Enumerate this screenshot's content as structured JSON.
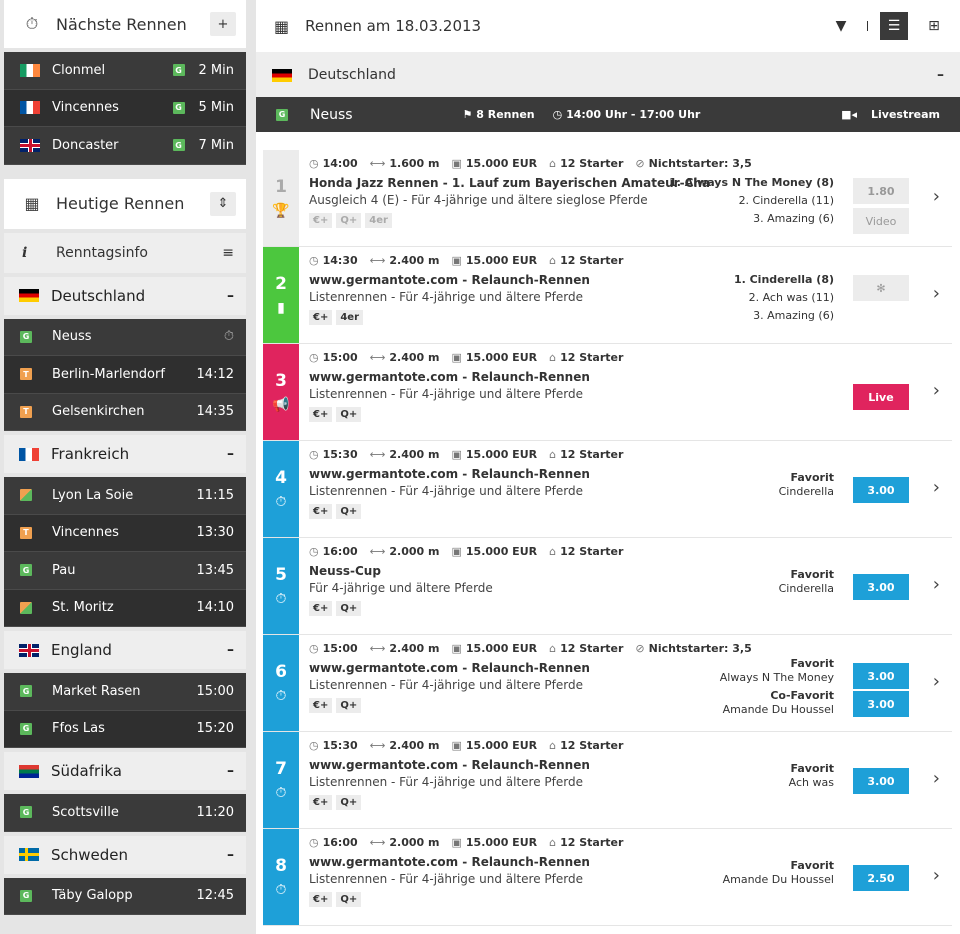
{
  "next_races": {
    "title": "Nächste Rennen",
    "add_icon": "+",
    "items": [
      {
        "name": "Clonmel",
        "type": "G",
        "time": "2 Min",
        "flag": "ie"
      },
      {
        "name": "Vincennes",
        "type": "G",
        "time": "5 Min",
        "flag": "fr"
      },
      {
        "name": "Doncaster",
        "type": "G",
        "time": "7 Min",
        "flag": "gb"
      }
    ]
  },
  "today": {
    "title": "Heutige Rennen",
    "info_label": "Renntagsinfo",
    "countries": [
      {
        "name": "Deutschland",
        "flag": "de",
        "tracks": [
          {
            "name": "Neuss",
            "type": "G",
            "time": ""
          },
          {
            "name": "Berlin-Marlendorf",
            "type": "T",
            "time": "14:12"
          },
          {
            "name": "Gelsenkirchen",
            "type": "T",
            "time": "14:35"
          }
        ]
      },
      {
        "name": "Frankreich",
        "flag": "fr",
        "tracks": [
          {
            "name": "Lyon La Soie",
            "type": "GT",
            "time": "11:15"
          },
          {
            "name": "Vincennes",
            "type": "T",
            "time": "13:30"
          },
          {
            "name": "Pau",
            "type": "G",
            "time": "13:45"
          },
          {
            "name": "St. Moritz",
            "type": "GT",
            "time": "14:10"
          }
        ]
      },
      {
        "name": "England",
        "flag": "gb",
        "tracks": [
          {
            "name": "Market Rasen",
            "type": "G",
            "time": "15:00"
          },
          {
            "name": "Ffos Las",
            "type": "G",
            "time": "15:20"
          }
        ]
      },
      {
        "name": "Südafrika",
        "flag": "za",
        "tracks": [
          {
            "name": "Scottsville",
            "type": "G",
            "time": "11:20"
          }
        ]
      },
      {
        "name": "Schweden",
        "flag": "se",
        "tracks": [
          {
            "name": "Täby Galopp",
            "type": "G",
            "time": "12:45"
          }
        ]
      }
    ]
  },
  "main": {
    "title": "Rennen am 18.03.2013",
    "country": "Deutschland",
    "track": "Neuss",
    "track_type": "G",
    "race_count": "8 Rennen",
    "time_range": "14:00 Uhr - 17:00 Uhr",
    "livestream": "Livestream",
    "races": [
      {
        "num": "1",
        "color": "#ececec",
        "time": "14:00",
        "dist": "1.600 m",
        "purse": "15.000 EUR",
        "starters": "12 Starter",
        "nonstarter": "Nichtstarter: 3,5",
        "title": "Honda Jazz Rennen - 1. Lauf zum Bayerischen Amateur-Cha...",
        "sub": "Ausgleich 4 (E) - Für 4-jährige und ältere sieglose Pferde",
        "tags": [
          "€+",
          "Q+",
          "4er"
        ],
        "results": [
          "1. Always N The Money (8)",
          "2. Cinderella (11)",
          "3. Amazing (6)"
        ],
        "btn": "1.80",
        "btn2": "Video"
      },
      {
        "num": "2",
        "color": "#4cc73e",
        "time": "14:30",
        "dist": "2.400 m",
        "purse": "15.000 EUR",
        "starters": "12 Starter",
        "nonstarter": "",
        "title": "www.germantote.com - Relaunch-Rennen",
        "sub": "Listenrennen - Für 4-jährige und ältere Pferde",
        "tags": [
          "€+",
          "4er"
        ],
        "results": [
          "1. Cinderella (8)",
          "2. Ach was (11)",
          "3. Amazing (6)"
        ],
        "btn": "",
        "btn2": ""
      },
      {
        "num": "3",
        "color": "#e0245e",
        "time": "15:00",
        "dist": "2.400 m",
        "purse": "15.000 EUR",
        "starters": "12 Starter",
        "nonstarter": "",
        "title": "www.germantote.com - Relaunch-Rennen",
        "sub": "Listenrennen - Für 4-jährige und ältere Pferde",
        "tags": [
          "€+",
          "Q+"
        ],
        "results": [],
        "btn": "Live",
        "btn2": ""
      },
      {
        "num": "4",
        "color": "#1ea0d8",
        "time": "15:30",
        "dist": "2.400 m",
        "purse": "15.000 EUR",
        "starters": "12 Starter",
        "nonstarter": "",
        "title": "www.germantote.com - Relaunch-Rennen",
        "sub": "Listenrennen - Für 4-jährige und ältere Pferde",
        "tags": [
          "€+",
          "Q+"
        ],
        "fav": [
          "Favorit",
          "Cinderella"
        ],
        "btn": "3.00",
        "btn2": ""
      },
      {
        "num": "5",
        "color": "#1ea0d8",
        "time": "16:00",
        "dist": "2.000 m",
        "purse": "15.000 EUR",
        "starters": "12 Starter",
        "nonstarter": "",
        "title": "Neuss-Cup",
        "sub": "Für 4-jährige und ältere Pferde",
        "tags": [
          "€+",
          "Q+"
        ],
        "fav": [
          "Favorit",
          "Cinderella"
        ],
        "btn": "3.00",
        "btn2": ""
      },
      {
        "num": "6",
        "color": "#1ea0d8",
        "time": "15:00",
        "dist": "2.400 m",
        "purse": "15.000 EUR",
        "starters": "12 Starter",
        "nonstarter": "Nichtstarter: 3,5",
        "title": "www.germantote.com - Relaunch-Rennen",
        "sub": "Listenrennen - Für 4-jährige und ältere Pferde",
        "tags": [
          "€+",
          "Q+"
        ],
        "fav": [
          "Favorit",
          "Always N The Money",
          "Co-Favorit",
          "Amande Du Houssel"
        ],
        "btn": "3.00",
        "btn2": "3.00"
      },
      {
        "num": "7",
        "color": "#1ea0d8",
        "time": "15:30",
        "dist": "2.400 m",
        "purse": "15.000 EUR",
        "starters": "12 Starter",
        "nonstarter": "",
        "title": "www.germantote.com - Relaunch-Rennen",
        "sub": "Listenrennen - Für 4-jährige und ältere Pferde",
        "tags": [
          "€+",
          "Q+"
        ],
        "fav": [
          "Favorit",
          "Ach was"
        ],
        "btn": "3.00",
        "btn2": ""
      },
      {
        "num": "8",
        "color": "#1ea0d8",
        "time": "16:00",
        "dist": "2.000 m",
        "purse": "15.000 EUR",
        "starters": "12 Starter",
        "nonstarter": "",
        "title": "www.germantote.com - Relaunch-Rennen",
        "sub": "Listenrennen - Für 4-jährige und ältere Pferde",
        "tags": [
          "€+",
          "Q+"
        ],
        "fav": [
          "Favorit",
          "Amande Du Houssel"
        ],
        "btn": "2.50",
        "btn2": ""
      }
    ]
  }
}
